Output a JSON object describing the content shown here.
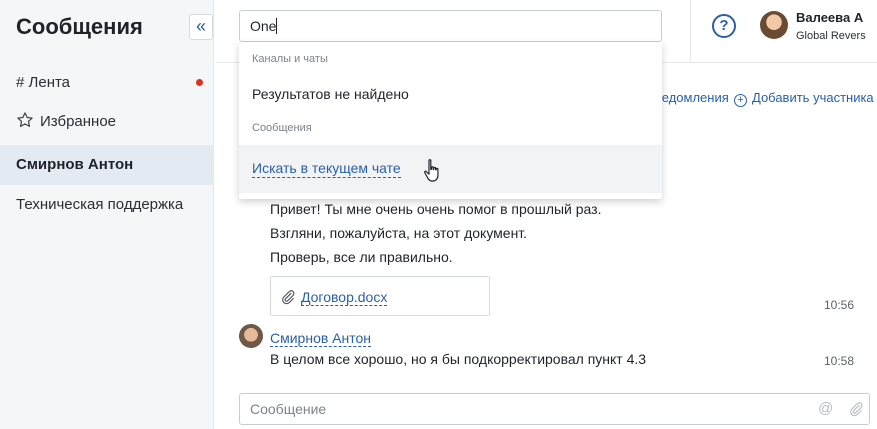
{
  "sidebar": {
    "title": "Сообщения",
    "collapse_glyph": "«",
    "items": [
      {
        "label": "# Лента",
        "has_unread_dot": true
      },
      {
        "label": "Избранное",
        "icon": "star-icon"
      },
      {
        "label": "Смирнов Антон",
        "active": true
      },
      {
        "label": "Техническая поддержка"
      }
    ]
  },
  "header": {
    "help_glyph": "?",
    "user": {
      "name": "Валеева А",
      "subtitle": "Global Revers"
    }
  },
  "search": {
    "value": "One",
    "dropdown": {
      "channels_section": "Каналы и чаты",
      "no_results": "Результатов не найдено",
      "messages_section": "Сообщения",
      "search_in_chat": "Искать в текущем чате"
    }
  },
  "chat_actions": {
    "notifications_label": "ведомления",
    "add_participant_label": "Добавить участника"
  },
  "messages": [
    {
      "lines": [
        "Привет! Ты мне очень очень помог в прошлый раз.",
        "Взгляни, пожалуйста, на этот документ.",
        "Проверь, все ли правильно."
      ],
      "attachment": "Договор.docx",
      "time": "10:56"
    },
    {
      "author": "Смирнов Антон",
      "text": "В целом все хорошо, но я бы подкорректировал пункт 4.3",
      "time": "10:58"
    }
  ],
  "composer": {
    "placeholder": "Сообщение",
    "at_glyph": "@"
  },
  "colors": {
    "accent": "#2a5fa8",
    "unread_dot": "#e0301e",
    "sidebar_bg": "#f4f6f8",
    "active_bg": "#e3eaf2"
  }
}
